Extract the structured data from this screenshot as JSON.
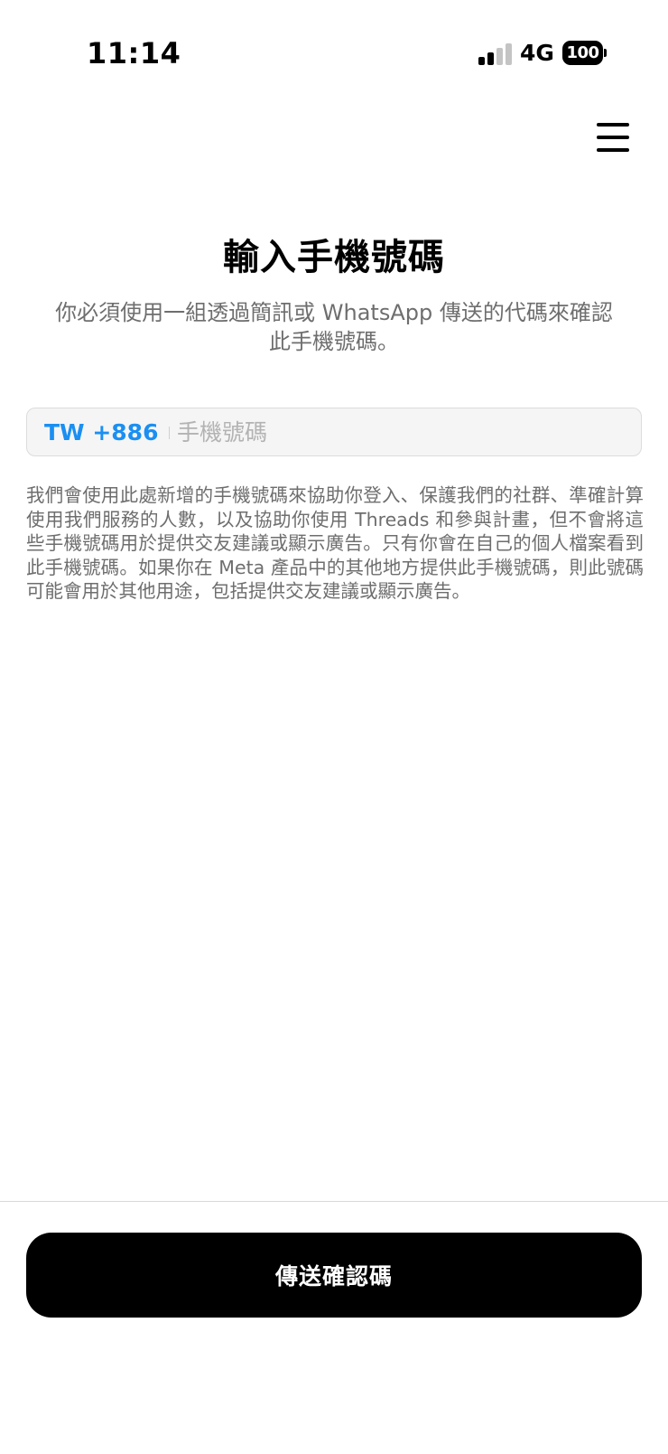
{
  "status_bar": {
    "time": "11:14",
    "network": "4G",
    "battery": "100",
    "signal_bars_active": 2,
    "signal_bars_total": 4
  },
  "header": {
    "menu_icon": "hamburger-menu-icon"
  },
  "main": {
    "title": "輸入手機號碼",
    "subtitle": "你必須使用一組透過簡訊或 WhatsApp 傳送的代碼來確認此手機號碼。",
    "phone_field": {
      "country_code": "TW +886",
      "value": "",
      "placeholder": "手機號碼"
    },
    "disclaimer": "我們會使用此處新增的手機號碼來協助你登入、保護我們的社群、準確計算使用我們服務的人數，以及協助你使用 Threads 和參與計畫，但不會將這些手機號碼用於提供交友建議或顯示廣告。只有你會在自己的個人檔案看到此手機號碼。如果你在 Meta 產品中的其他地方提供此手機號碼，則此號碼可能會用於其他用途，包括提供交友建議或顯示廣告。"
  },
  "footer": {
    "send_button_label": "傳送確認碼"
  },
  "colors": {
    "accent": "#1b8ff2",
    "text_secondary": "#6e6e6e",
    "button_bg": "#000000",
    "field_bg": "#f5f5f5"
  }
}
